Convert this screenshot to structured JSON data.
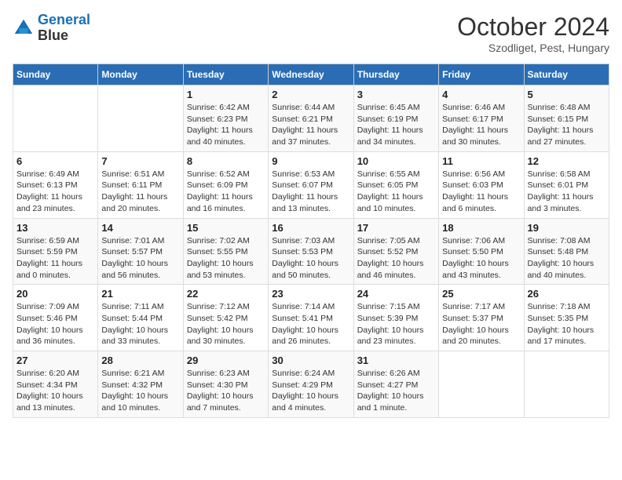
{
  "header": {
    "logo_line1": "General",
    "logo_line2": "Blue",
    "month": "October 2024",
    "location": "Szodliget, Pest, Hungary"
  },
  "weekdays": [
    "Sunday",
    "Monday",
    "Tuesday",
    "Wednesday",
    "Thursday",
    "Friday",
    "Saturday"
  ],
  "weeks": [
    [
      {
        "day": "",
        "info": ""
      },
      {
        "day": "",
        "info": ""
      },
      {
        "day": "1",
        "info": "Sunrise: 6:42 AM\nSunset: 6:23 PM\nDaylight: 11 hours and 40 minutes."
      },
      {
        "day": "2",
        "info": "Sunrise: 6:44 AM\nSunset: 6:21 PM\nDaylight: 11 hours and 37 minutes."
      },
      {
        "day": "3",
        "info": "Sunrise: 6:45 AM\nSunset: 6:19 PM\nDaylight: 11 hours and 34 minutes."
      },
      {
        "day": "4",
        "info": "Sunrise: 6:46 AM\nSunset: 6:17 PM\nDaylight: 11 hours and 30 minutes."
      },
      {
        "day": "5",
        "info": "Sunrise: 6:48 AM\nSunset: 6:15 PM\nDaylight: 11 hours and 27 minutes."
      }
    ],
    [
      {
        "day": "6",
        "info": "Sunrise: 6:49 AM\nSunset: 6:13 PM\nDaylight: 11 hours and 23 minutes."
      },
      {
        "day": "7",
        "info": "Sunrise: 6:51 AM\nSunset: 6:11 PM\nDaylight: 11 hours and 20 minutes."
      },
      {
        "day": "8",
        "info": "Sunrise: 6:52 AM\nSunset: 6:09 PM\nDaylight: 11 hours and 16 minutes."
      },
      {
        "day": "9",
        "info": "Sunrise: 6:53 AM\nSunset: 6:07 PM\nDaylight: 11 hours and 13 minutes."
      },
      {
        "day": "10",
        "info": "Sunrise: 6:55 AM\nSunset: 6:05 PM\nDaylight: 11 hours and 10 minutes."
      },
      {
        "day": "11",
        "info": "Sunrise: 6:56 AM\nSunset: 6:03 PM\nDaylight: 11 hours and 6 minutes."
      },
      {
        "day": "12",
        "info": "Sunrise: 6:58 AM\nSunset: 6:01 PM\nDaylight: 11 hours and 3 minutes."
      }
    ],
    [
      {
        "day": "13",
        "info": "Sunrise: 6:59 AM\nSunset: 5:59 PM\nDaylight: 11 hours and 0 minutes."
      },
      {
        "day": "14",
        "info": "Sunrise: 7:01 AM\nSunset: 5:57 PM\nDaylight: 10 hours and 56 minutes."
      },
      {
        "day": "15",
        "info": "Sunrise: 7:02 AM\nSunset: 5:55 PM\nDaylight: 10 hours and 53 minutes."
      },
      {
        "day": "16",
        "info": "Sunrise: 7:03 AM\nSunset: 5:53 PM\nDaylight: 10 hours and 50 minutes."
      },
      {
        "day": "17",
        "info": "Sunrise: 7:05 AM\nSunset: 5:52 PM\nDaylight: 10 hours and 46 minutes."
      },
      {
        "day": "18",
        "info": "Sunrise: 7:06 AM\nSunset: 5:50 PM\nDaylight: 10 hours and 43 minutes."
      },
      {
        "day": "19",
        "info": "Sunrise: 7:08 AM\nSunset: 5:48 PM\nDaylight: 10 hours and 40 minutes."
      }
    ],
    [
      {
        "day": "20",
        "info": "Sunrise: 7:09 AM\nSunset: 5:46 PM\nDaylight: 10 hours and 36 minutes."
      },
      {
        "day": "21",
        "info": "Sunrise: 7:11 AM\nSunset: 5:44 PM\nDaylight: 10 hours and 33 minutes."
      },
      {
        "day": "22",
        "info": "Sunrise: 7:12 AM\nSunset: 5:42 PM\nDaylight: 10 hours and 30 minutes."
      },
      {
        "day": "23",
        "info": "Sunrise: 7:14 AM\nSunset: 5:41 PM\nDaylight: 10 hours and 26 minutes."
      },
      {
        "day": "24",
        "info": "Sunrise: 7:15 AM\nSunset: 5:39 PM\nDaylight: 10 hours and 23 minutes."
      },
      {
        "day": "25",
        "info": "Sunrise: 7:17 AM\nSunset: 5:37 PM\nDaylight: 10 hours and 20 minutes."
      },
      {
        "day": "26",
        "info": "Sunrise: 7:18 AM\nSunset: 5:35 PM\nDaylight: 10 hours and 17 minutes."
      }
    ],
    [
      {
        "day": "27",
        "info": "Sunrise: 6:20 AM\nSunset: 4:34 PM\nDaylight: 10 hours and 13 minutes."
      },
      {
        "day": "28",
        "info": "Sunrise: 6:21 AM\nSunset: 4:32 PM\nDaylight: 10 hours and 10 minutes."
      },
      {
        "day": "29",
        "info": "Sunrise: 6:23 AM\nSunset: 4:30 PM\nDaylight: 10 hours and 7 minutes."
      },
      {
        "day": "30",
        "info": "Sunrise: 6:24 AM\nSunset: 4:29 PM\nDaylight: 10 hours and 4 minutes."
      },
      {
        "day": "31",
        "info": "Sunrise: 6:26 AM\nSunset: 4:27 PM\nDaylight: 10 hours and 1 minute."
      },
      {
        "day": "",
        "info": ""
      },
      {
        "day": "",
        "info": ""
      }
    ]
  ]
}
